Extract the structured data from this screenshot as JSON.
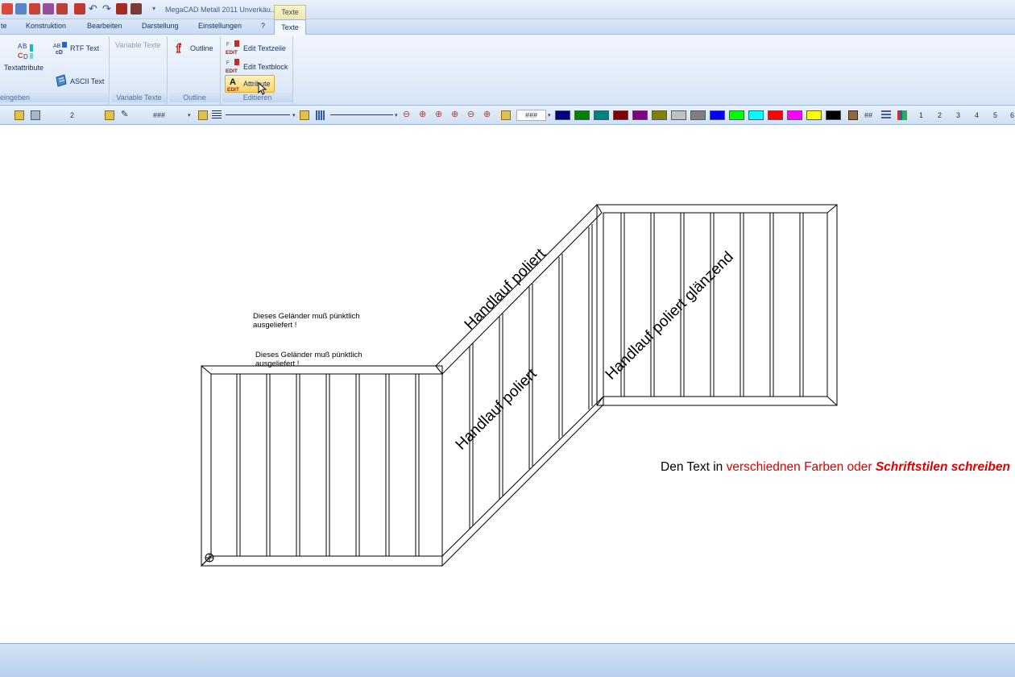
{
  "titlebar": {
    "app_title": "MegaCAD Metall 2011  Unverkäu...",
    "context_tab_title": "Texte",
    "quick_access_icons": [
      "new-icon",
      "open-icon",
      "save-icon",
      "print-icon",
      "snap-icon",
      "plot-icon",
      "undo-icon",
      "redo-icon",
      "text-tool-icon",
      "text-edit-icon"
    ],
    "more_glyph": "▾"
  },
  "tabs": {
    "t0": "te",
    "t1": "Konstruktion",
    "t2": "Bearbeiten",
    "t3": "Darstellung",
    "t4": "Einstellungen",
    "t5": "?",
    "active": "Texte"
  },
  "ribbon": {
    "group_eingeben": {
      "label": "eingeben",
      "textattribute": "Textattribute",
      "rtf_text": "RTF Text",
      "ascii_text": "ASCII Text"
    },
    "group_variable": {
      "label": "Variable Texte",
      "variable_texte": "Variable Texte"
    },
    "group_outline": {
      "label": "Outline",
      "outline": "Outline"
    },
    "group_editieren": {
      "label": "Editieren",
      "edit_textzeile": "Edit Textzeile",
      "edit_textblock": "Edit Textblock",
      "attribute": "Attribute",
      "icon_edit_label": "EDIT",
      "icon_abc_a": "A",
      "icon_abc_b": "B",
      "icon_abc_c": "C",
      "icon_abc_d": "D",
      "icon_f_label": "f"
    }
  },
  "toolbar": {
    "layer_value": "2",
    "pattern_value": "###",
    "field_value": "###",
    "hash_label": "##",
    "numbers": [
      "1",
      "2",
      "3",
      "4",
      "5",
      "6"
    ],
    "colors": [
      "#000080",
      "#008000",
      "#008080",
      "#800000",
      "#800080",
      "#808000",
      "#c0c0c0",
      "#808080",
      "#0000ff",
      "#00ff00",
      "#00ffff",
      "#ff0000",
      "#ff00ff",
      "#ffff00",
      "#000000"
    ]
  },
  "drawing": {
    "note_1_line1": "Dieses Geländer muß pünktlich",
    "note_1_line2": "ausgeliefert !",
    "note_2_line1": "Dieses Geländer muß pünktlich",
    "note_2_line2": "ausgeliefert !",
    "label_upper_rail": "Handlauf poliert",
    "label_middle": "Handlauf poliert",
    "label_right": "Handlauf poliert glänzend",
    "caption_black": "Den Text in ",
    "caption_red": "verschiednen Farben oder ",
    "caption_red_bold_italic": "Schriftstilen schreiben",
    "caption_color_black": "#000000",
    "caption_color_red": "#e00000",
    "origin_marker": "⊕"
  }
}
